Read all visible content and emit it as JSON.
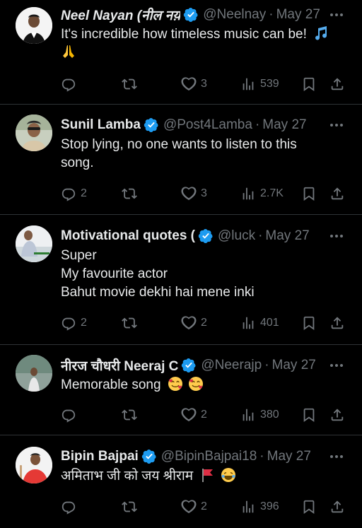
{
  "colors": {
    "background": "#000000",
    "text": "#e7e9ea",
    "muted": "#71767b",
    "divider": "#2f3336",
    "verified": "#1d9bf0"
  },
  "tweets": [
    {
      "name": "Neel Nayan (नील नय़",
      "verified": true,
      "handle": "@Neelnay",
      "time": "May 27",
      "lines": [
        "It's incredible how timeless music can be!"
      ],
      "emoji_lines": [
        [
          "musical-notes"
        ],
        [
          "folded-hands"
        ]
      ],
      "replies": "",
      "retweets": "",
      "likes": "3",
      "views": "539"
    },
    {
      "name": "Sunil Lamba",
      "verified": true,
      "handle": "@Post4Lamba",
      "time": "May 27",
      "lines": [
        "Stop lying, no one wants to listen to this",
        "song."
      ],
      "replies": "2",
      "retweets": "",
      "likes": "3",
      "views": "2.7K"
    },
    {
      "name": "Motivational quotes (",
      "verified": true,
      "handle": "@luck",
      "time": "May 27",
      "lines": [
        "Super",
        "My favourite actor",
        "Bahut movie dekhi hai mene inki"
      ],
      "replies": "2",
      "retweets": "",
      "likes": "2",
      "views": "401"
    },
    {
      "name": "नीरज चौधरी Neeraj C",
      "verified": true,
      "handle": "@Neerajp",
      "time": "May 27",
      "lines": [
        "Memorable song"
      ],
      "emoji": [
        "smiling-face-with-hearts",
        "smiling-face-with-hearts"
      ],
      "replies": "",
      "retweets": "",
      "likes": "2",
      "views": "380"
    },
    {
      "name": "Bipin Bajpai",
      "verified": true,
      "handle": "@BipinBajpai18",
      "time": "May 27",
      "lines": [
        "अमिताभ जी को जय श्रीराम"
      ],
      "emoji": [
        "red-flag",
        "face-with-tears-of-joy"
      ],
      "replies": "",
      "retweets": "",
      "likes": "2",
      "views": "396"
    }
  ],
  "separator": "·"
}
